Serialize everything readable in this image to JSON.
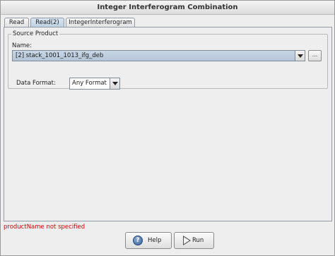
{
  "window": {
    "title": "Integer Interferogram Combination"
  },
  "tabs": [
    {
      "label": "Read",
      "active": false
    },
    {
      "label": "Read(2)",
      "active": true
    },
    {
      "label": "IntegerInterferogram",
      "active": false
    }
  ],
  "source_product": {
    "group_title": "Source Product",
    "name_label": "Name:",
    "name_value": "[2] stack_1001_1013_ifg_deb",
    "browse_label": "...",
    "format_label": "Data Format:",
    "format_value": "Any Format"
  },
  "status": {
    "message": "productName not specified",
    "color": "#d40000"
  },
  "buttons": {
    "help_label": "Help",
    "run_label": "Run"
  },
  "icons": {
    "help": "help-icon",
    "run": "run-icon",
    "name_dropdown": "chevron-down-icon",
    "format_dropdown": "chevron-down-icon"
  },
  "colors": {
    "selected_combo": "#b9cbdd",
    "active_tab": "#c3d5e8"
  }
}
